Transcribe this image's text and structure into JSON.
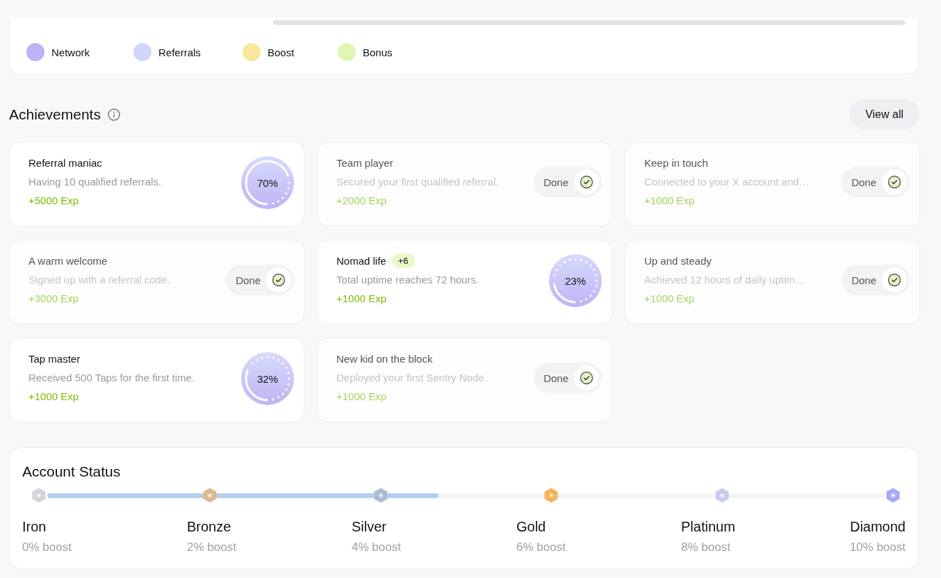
{
  "legend": [
    {
      "label": "Network",
      "color": "#bcb2f5"
    },
    {
      "label": "Referrals",
      "color": "#d0d5fd"
    },
    {
      "label": "Boost",
      "color": "#f8e79a"
    },
    {
      "label": "Bonus",
      "color": "#e0f5b4"
    }
  ],
  "achievements": {
    "title": "Achievements",
    "view_all": "View all",
    "items": [
      {
        "kind": "progress",
        "title": "Referral maniac",
        "description": "Having 10 qualified referrals.",
        "reward": "+5000 Exp",
        "level": 0.7,
        "reading": "70%"
      },
      {
        "kind": "done",
        "title": "Team player",
        "description": "Secured your first qualified referral.",
        "reward": "+2000 Exp",
        "status": "Done"
      },
      {
        "kind": "done",
        "title": "Keep in touch",
        "description": "Connected to your X account and…",
        "reward": "+1000 Exp",
        "status": "Done"
      },
      {
        "kind": "done",
        "title": "A warm welcome",
        "description": "Signed up with a referral code.",
        "reward": "+3000 Exp",
        "status": "Done"
      },
      {
        "kind": "progress",
        "title": "Nomad life",
        "badge": "+6",
        "description": "Total uptime reaches 72 hours.",
        "reward": "+1000 Exp",
        "level": 0.23,
        "reading": "23%"
      },
      {
        "kind": "done",
        "title": "Up and steady",
        "description": "Achieved 12 hours of daily uptim…",
        "reward": "+1000 Exp",
        "status": "Done"
      },
      {
        "kind": "progress",
        "title": "Tap master",
        "description": "Received 500 Taps for the first time.",
        "reward": "+1000 Exp",
        "level": 0.32,
        "reading": "32%"
      },
      {
        "kind": "done",
        "title": "New kid on the block",
        "description": "Deployed your first Sentry Node.",
        "reward": "+1000 Exp",
        "status": "Done"
      }
    ]
  },
  "account_status": {
    "title": "Account Status",
    "level": 0.467,
    "tiers": [
      {
        "name": "Iron",
        "boost": "0% boost",
        "color": "#d3d4d8"
      },
      {
        "name": "Bronze",
        "boost": "2% boost",
        "color": "#dcb98e"
      },
      {
        "name": "Silver",
        "boost": "4% boost",
        "color": "#a9bdd4"
      },
      {
        "name": "Gold",
        "boost": "6% boost",
        "color": "#fbb257"
      },
      {
        "name": "Platinum",
        "boost": "8% boost",
        "color": "#c9cbee"
      },
      {
        "name": "Diamond",
        "boost": "10% boost",
        "color": "#a7aaf7"
      }
    ]
  }
}
